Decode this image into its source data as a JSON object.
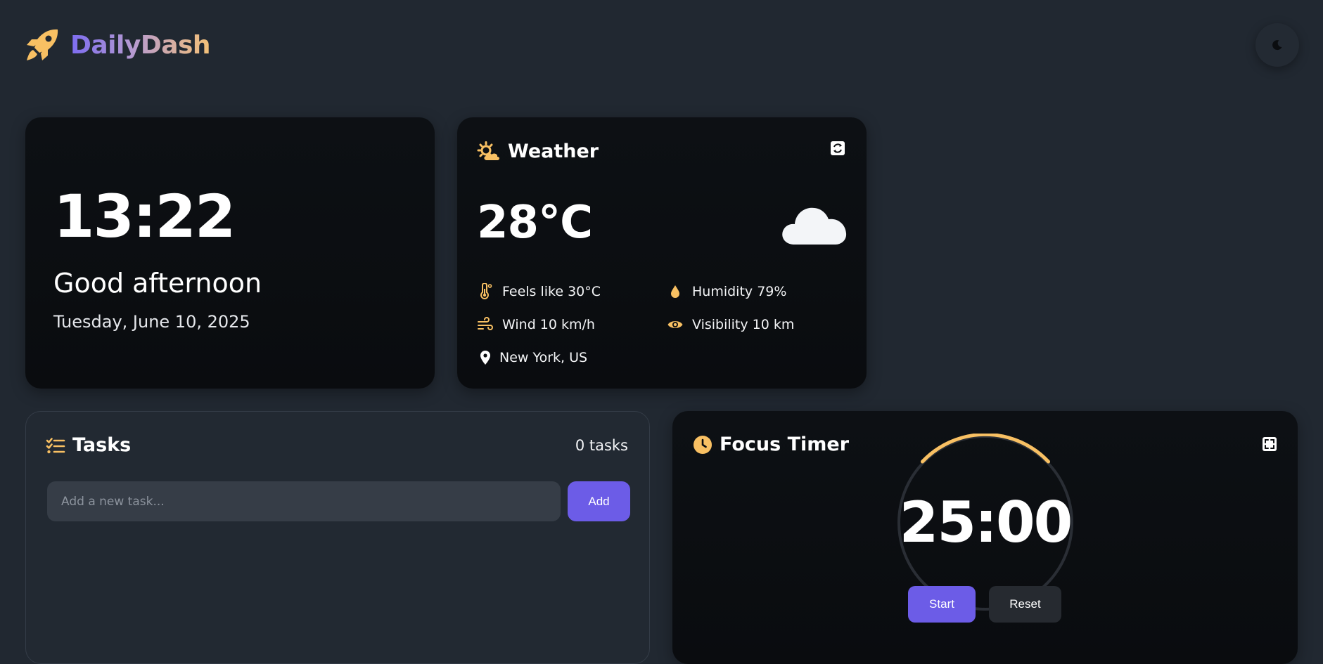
{
  "app": {
    "name": "DailyDash",
    "brand_colors": [
      "#7c6cf0",
      "#f4c178"
    ],
    "accent": "#6c5ce7",
    "icon_color": "#f8c063"
  },
  "header": {
    "logo_icon": "rocket-icon",
    "theme_toggle_icon": "moon-icon"
  },
  "clock": {
    "time": "13:22",
    "greeting": "Good afternoon",
    "date": "Tuesday, June 10, 2025"
  },
  "weather": {
    "title": "Weather",
    "title_icon": "sun-cloud-icon",
    "refresh_icon": "refresh-icon",
    "temperature": "28°C",
    "condition_icon": "cloud-icon",
    "feels_like": "Feels like 30°C",
    "humidity": "Humidity 79%",
    "wind": "Wind 10 km/h",
    "visibility": "Visibility 10 km",
    "location": "New York, US"
  },
  "tasks": {
    "title": "Tasks",
    "title_icon": "checklist-icon",
    "count": "0 tasks",
    "input_placeholder": "Add a new task...",
    "add_label": "Add"
  },
  "timer": {
    "title": "Focus Timer",
    "title_icon": "clock-icon",
    "expand_icon": "expand-icon",
    "display": "25:00",
    "start_label": "Start",
    "reset_label": "Reset"
  }
}
